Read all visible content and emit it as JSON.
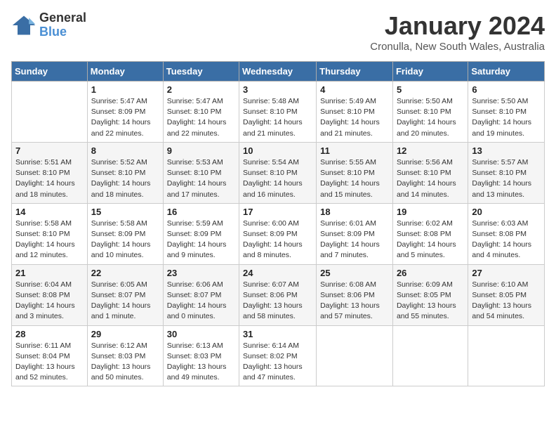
{
  "header": {
    "logo_line1": "General",
    "logo_line2": "Blue",
    "month_year": "January 2024",
    "location": "Cronulla, New South Wales, Australia"
  },
  "weekdays": [
    "Sunday",
    "Monday",
    "Tuesday",
    "Wednesday",
    "Thursday",
    "Friday",
    "Saturday"
  ],
  "weeks": [
    [
      {
        "day": "",
        "info": ""
      },
      {
        "day": "1",
        "info": "Sunrise: 5:47 AM\nSunset: 8:09 PM\nDaylight: 14 hours\nand 22 minutes."
      },
      {
        "day": "2",
        "info": "Sunrise: 5:47 AM\nSunset: 8:10 PM\nDaylight: 14 hours\nand 22 minutes."
      },
      {
        "day": "3",
        "info": "Sunrise: 5:48 AM\nSunset: 8:10 PM\nDaylight: 14 hours\nand 21 minutes."
      },
      {
        "day": "4",
        "info": "Sunrise: 5:49 AM\nSunset: 8:10 PM\nDaylight: 14 hours\nand 21 minutes."
      },
      {
        "day": "5",
        "info": "Sunrise: 5:50 AM\nSunset: 8:10 PM\nDaylight: 14 hours\nand 20 minutes."
      },
      {
        "day": "6",
        "info": "Sunrise: 5:50 AM\nSunset: 8:10 PM\nDaylight: 14 hours\nand 19 minutes."
      }
    ],
    [
      {
        "day": "7",
        "info": "Sunrise: 5:51 AM\nSunset: 8:10 PM\nDaylight: 14 hours\nand 18 minutes."
      },
      {
        "day": "8",
        "info": "Sunrise: 5:52 AM\nSunset: 8:10 PM\nDaylight: 14 hours\nand 18 minutes."
      },
      {
        "day": "9",
        "info": "Sunrise: 5:53 AM\nSunset: 8:10 PM\nDaylight: 14 hours\nand 17 minutes."
      },
      {
        "day": "10",
        "info": "Sunrise: 5:54 AM\nSunset: 8:10 PM\nDaylight: 14 hours\nand 16 minutes."
      },
      {
        "day": "11",
        "info": "Sunrise: 5:55 AM\nSunset: 8:10 PM\nDaylight: 14 hours\nand 15 minutes."
      },
      {
        "day": "12",
        "info": "Sunrise: 5:56 AM\nSunset: 8:10 PM\nDaylight: 14 hours\nand 14 minutes."
      },
      {
        "day": "13",
        "info": "Sunrise: 5:57 AM\nSunset: 8:10 PM\nDaylight: 14 hours\nand 13 minutes."
      }
    ],
    [
      {
        "day": "14",
        "info": "Sunrise: 5:58 AM\nSunset: 8:10 PM\nDaylight: 14 hours\nand 12 minutes."
      },
      {
        "day": "15",
        "info": "Sunrise: 5:58 AM\nSunset: 8:09 PM\nDaylight: 14 hours\nand 10 minutes."
      },
      {
        "day": "16",
        "info": "Sunrise: 5:59 AM\nSunset: 8:09 PM\nDaylight: 14 hours\nand 9 minutes."
      },
      {
        "day": "17",
        "info": "Sunrise: 6:00 AM\nSunset: 8:09 PM\nDaylight: 14 hours\nand 8 minutes."
      },
      {
        "day": "18",
        "info": "Sunrise: 6:01 AM\nSunset: 8:09 PM\nDaylight: 14 hours\nand 7 minutes."
      },
      {
        "day": "19",
        "info": "Sunrise: 6:02 AM\nSunset: 8:08 PM\nDaylight: 14 hours\nand 5 minutes."
      },
      {
        "day": "20",
        "info": "Sunrise: 6:03 AM\nSunset: 8:08 PM\nDaylight: 14 hours\nand 4 minutes."
      }
    ],
    [
      {
        "day": "21",
        "info": "Sunrise: 6:04 AM\nSunset: 8:08 PM\nDaylight: 14 hours\nand 3 minutes."
      },
      {
        "day": "22",
        "info": "Sunrise: 6:05 AM\nSunset: 8:07 PM\nDaylight: 14 hours\nand 1 minute."
      },
      {
        "day": "23",
        "info": "Sunrise: 6:06 AM\nSunset: 8:07 PM\nDaylight: 14 hours\nand 0 minutes."
      },
      {
        "day": "24",
        "info": "Sunrise: 6:07 AM\nSunset: 8:06 PM\nDaylight: 13 hours\nand 58 minutes."
      },
      {
        "day": "25",
        "info": "Sunrise: 6:08 AM\nSunset: 8:06 PM\nDaylight: 13 hours\nand 57 minutes."
      },
      {
        "day": "26",
        "info": "Sunrise: 6:09 AM\nSunset: 8:05 PM\nDaylight: 13 hours\nand 55 minutes."
      },
      {
        "day": "27",
        "info": "Sunrise: 6:10 AM\nSunset: 8:05 PM\nDaylight: 13 hours\nand 54 minutes."
      }
    ],
    [
      {
        "day": "28",
        "info": "Sunrise: 6:11 AM\nSunset: 8:04 PM\nDaylight: 13 hours\nand 52 minutes."
      },
      {
        "day": "29",
        "info": "Sunrise: 6:12 AM\nSunset: 8:03 PM\nDaylight: 13 hours\nand 50 minutes."
      },
      {
        "day": "30",
        "info": "Sunrise: 6:13 AM\nSunset: 8:03 PM\nDaylight: 13 hours\nand 49 minutes."
      },
      {
        "day": "31",
        "info": "Sunrise: 6:14 AM\nSunset: 8:02 PM\nDaylight: 13 hours\nand 47 minutes."
      },
      {
        "day": "",
        "info": ""
      },
      {
        "day": "",
        "info": ""
      },
      {
        "day": "",
        "info": ""
      }
    ]
  ]
}
